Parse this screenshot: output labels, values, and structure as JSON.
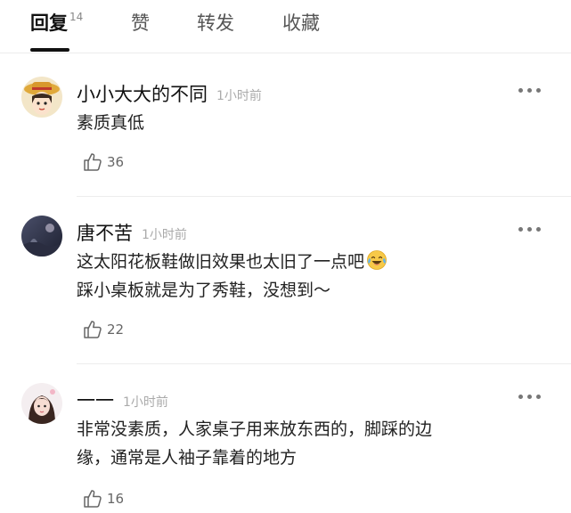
{
  "tabs": [
    {
      "label": "回复",
      "count": "14"
    },
    {
      "label": "赞"
    },
    {
      "label": "转发"
    },
    {
      "label": "收藏"
    }
  ],
  "comments": [
    {
      "author": "小小大大的不同",
      "time": "1小时前",
      "lines": [
        "素质真低"
      ],
      "likes": "36"
    },
    {
      "author": "唐不苦",
      "time": "1小时前",
      "lines": [
        "这太阳花板鞋做旧效果也太旧了一点吧",
        "踩小桌板就是为了秀鞋，没想到～"
      ],
      "emoji": "laughing-tears-icon",
      "likes": "22"
    },
    {
      "author": "一一",
      "time": "1小时前",
      "lines": [
        "非常没素质，人家桌子用来放东西的，脚踩的边",
        "缘，通常是人袖子靠着的地方"
      ],
      "likes": "16"
    }
  ],
  "colors": {
    "text": "#222222",
    "muted": "#aaaaaa",
    "divider": "#ededed",
    "active_tab": "#111111"
  }
}
